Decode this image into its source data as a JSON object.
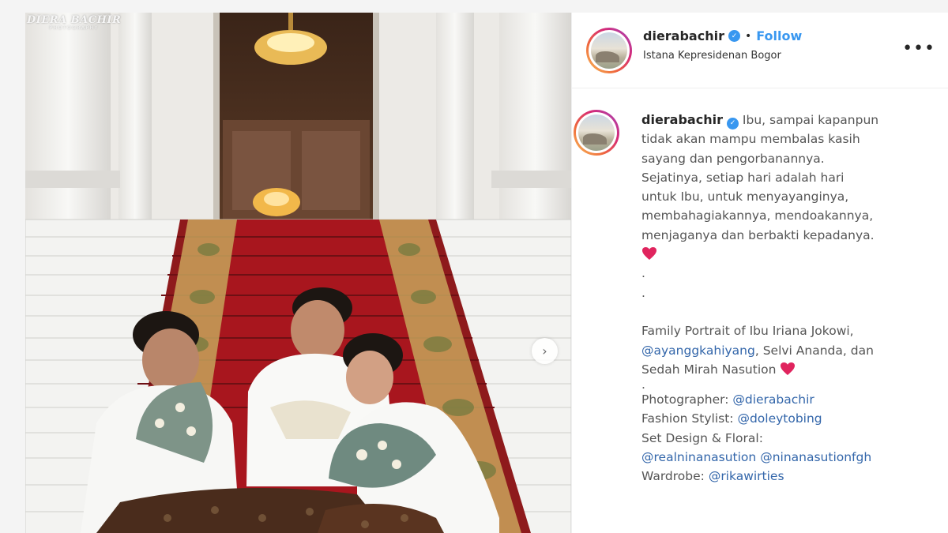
{
  "watermark": {
    "name": "DIERA BACHIR",
    "sub": "PHOTOGRAPHY"
  },
  "header": {
    "username": "dierabachir",
    "separator": "•",
    "follow_label": "Follow",
    "location": "Istana Kepresidenan Bogor",
    "more_label": "•••"
  },
  "caption": {
    "username": "dierabachir",
    "first_line": "Ibu, sampai kapanpun",
    "lines": [
      "tidak akan mampu membalas kasih",
      "sayang dan pengorbanannya.",
      "Sejatinya, setiap hari adalah hari",
      "untuk Ibu, untuk menyayanginya,",
      "membahagiakannya, mendoakannya,",
      "menjaganya dan berbakti kepadanya."
    ],
    "dot": ".",
    "family_line1": "Family Portrait of Ibu Iriana Jokowi,",
    "family_mention": "@ayanggkahiyang",
    "family_line2_rest": ", Selvi Ananda, dan",
    "family_line3": "Sedah Mirah Nasution",
    "photographer_label": "Photographer: ",
    "photographer": "@dierabachir",
    "stylist_label": "Fashion Stylist: ",
    "stylist": "@doleytobing",
    "set_label": "Set Design & Floral:",
    "floral_1": "@realninanasution",
    "floral_2": "@ninanasutionfgh",
    "wardrobe_label": "Wardrobe: ",
    "wardrobe": "@rikawirties"
  },
  "colors": {
    "accent": "#3897f0",
    "heart": "#e0245e",
    "mention": "#3366aa",
    "carpet": "#a8161e"
  },
  "icons": {
    "verified": "verified-badge-icon",
    "heart": "red-heart-icon",
    "next": "chevron-right-icon",
    "more": "more-options-icon"
  }
}
